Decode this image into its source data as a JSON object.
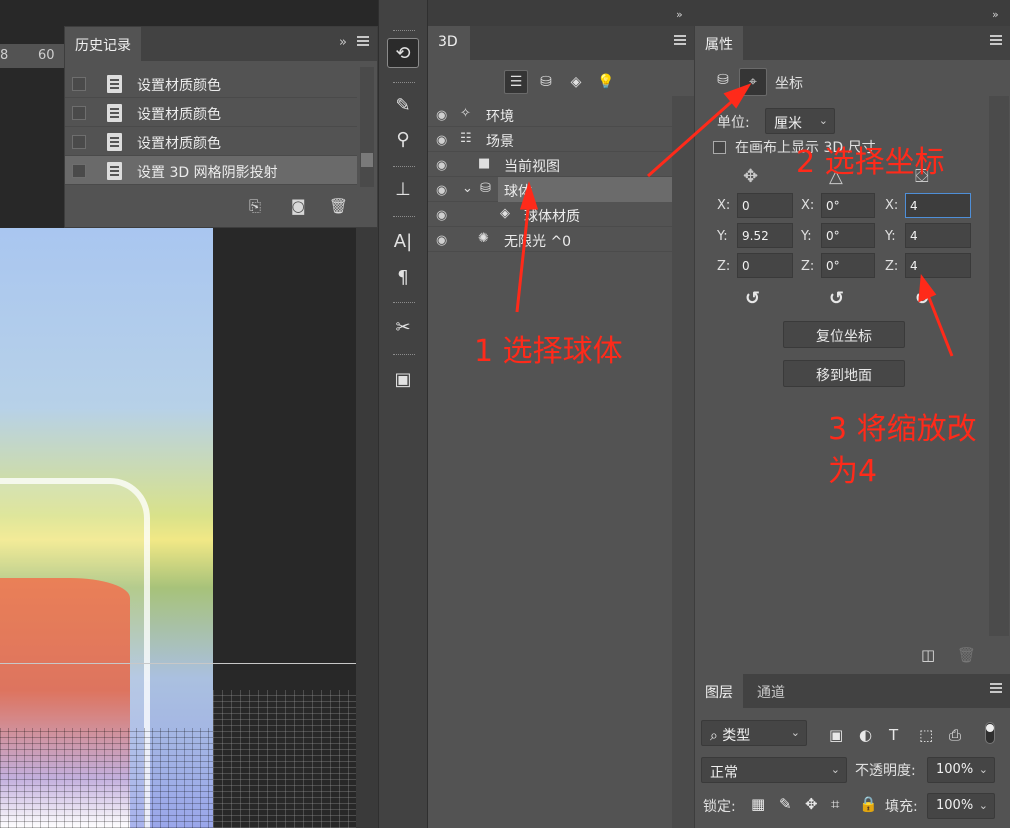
{
  "ruler": {
    "ticks": [
      "8",
      "60"
    ]
  },
  "history": {
    "tab": "历史记录",
    "collapse": "»",
    "rows": [
      "设置材质颜色",
      "设置材质颜色",
      "设置材质颜色",
      "设置 3D 网格阴影投射"
    ],
    "footer_icons": [
      "new-doc-from-state-icon",
      "camera-icon",
      "trash-icon"
    ]
  },
  "panel3d": {
    "tab": "3D",
    "filter_icons": [
      "whole-scene-icon",
      "mesh-icon",
      "material-icon",
      "light-icon"
    ],
    "scene": [
      {
        "label": "环境",
        "icon": "environment-icon"
      },
      {
        "label": "场景",
        "icon": "scene-icon"
      },
      {
        "label": "当前视图",
        "icon": "camera-icon"
      },
      {
        "label": "球体",
        "icon": "mesh-icon"
      },
      {
        "label": "球体材质",
        "icon": "material-icon"
      },
      {
        "label": "无限光 ^0",
        "icon": "light-icon"
      }
    ]
  },
  "props": {
    "tab": "属性",
    "section": "坐标",
    "unit_label": "单位:",
    "unit_value": "厘米",
    "show_3d_size": "在画布上显示 3D 尺寸",
    "position": {
      "x": "0",
      "y": "9.52",
      "z": "0"
    },
    "rotation": {
      "x": "0°",
      "y": "0°",
      "z": "0°"
    },
    "scale": {
      "x": "4",
      "y": "4",
      "z": "4"
    },
    "axis_labels": {
      "x": "X:",
      "y": "Y:",
      "z": "Z:"
    },
    "reset_coords": "复位坐标",
    "move_to_ground": "移到地面"
  },
  "layers": {
    "tabs": [
      "图层",
      "通道"
    ],
    "filter": "类型",
    "blend_mode": "正常",
    "opacity_label": "不透明度:",
    "opacity_value": "100%",
    "lock_label": "锁定:",
    "fill_label": "填充:",
    "fill_value": "100%"
  },
  "annotations": {
    "step1": "1 选择球体",
    "step2": "2 选择坐标",
    "step3_line1": "3 将缩放改",
    "step3_line2": "为4"
  },
  "colors": {
    "annotation": "#ff2a1a",
    "focus": "#4f8fd8"
  }
}
